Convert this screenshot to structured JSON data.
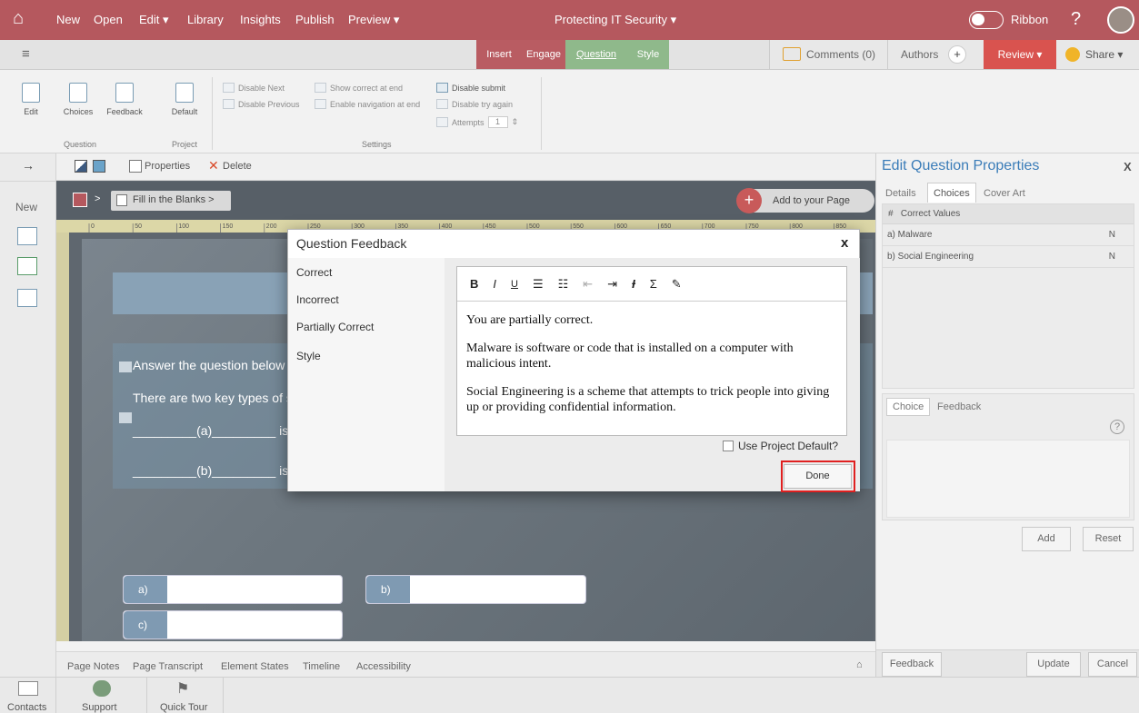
{
  "topbar": {
    "nav": [
      "New",
      "Open",
      "Edit ▾",
      "Library",
      "Insights",
      "Publish",
      "Preview ▾"
    ],
    "title": "Protecting IT Security ▾",
    "ribbon_toggle": "Ribbon",
    "help": "?"
  },
  "toolbar2": {
    "menu": "≡",
    "tabs": [
      "Insert",
      "Engage",
      "Question",
      "Style"
    ],
    "comments": "Comments (0)",
    "authors": "Authors",
    "authors_add": "+",
    "review": "Review ▾",
    "share": "Share ▾"
  },
  "ribbon": {
    "buttons": [
      "Edit",
      "Choices",
      "Feedback",
      "Default"
    ],
    "groups": [
      "Question",
      "Project",
      "Settings"
    ],
    "settings": [
      "Disable Next",
      "Disable Previous",
      "Show correct at end",
      "Enable navigation at end",
      "Disable submit",
      "Disable try again",
      "Attempts"
    ],
    "attempts_value": "1"
  },
  "leftrail": {
    "arrow": "→",
    "new": "New"
  },
  "canvas_toolbar": {
    "properties": "Properties",
    "delete": "Delete"
  },
  "pathbar": {
    "sep": ">",
    "crumb": "Fill in the Blanks >",
    "add_page": "Add to your Page"
  },
  "ruler_ticks": [
    "0",
    "50",
    "100",
    "150",
    "200",
    "250",
    "300",
    "350",
    "400",
    "450",
    "500",
    "550",
    "600",
    "650",
    "700",
    "750",
    "800",
    "850"
  ],
  "slide": {
    "instruction": "Answer the question below",
    "line1": "There are two key types of s",
    "blank_a": "_________(a)_________ is",
    "blank_b": "_________(b)_________ is",
    "answers": [
      "a)",
      "b)",
      "c)"
    ]
  },
  "bottom_tabs": [
    "Page Notes",
    "Page Transcript",
    "Element States",
    "Timeline",
    "Accessibility"
  ],
  "right_panel": {
    "title": "Edit Question Properties",
    "close": "X",
    "tabs": [
      "Details",
      "Choices",
      "Cover Art"
    ],
    "table_header": {
      "num": "#",
      "label": "Correct Values"
    },
    "rows": [
      {
        "label": "a)  Malware",
        "flag": "N"
      },
      {
        "label": "b)  Social Engineering",
        "flag": "N"
      }
    ],
    "subtabs": [
      "Choice",
      "Feedback"
    ],
    "help": "?",
    "add": "Add",
    "reset": "Reset",
    "feedback_btn": "Feedback",
    "update": "Update",
    "cancel": "Cancel"
  },
  "modal": {
    "title": "Question Feedback",
    "close": "x",
    "nav": [
      "Correct",
      "Incorrect",
      "Partially Correct",
      "Style"
    ],
    "toolbar": [
      "B",
      "I",
      "U",
      "Σ"
    ],
    "paragraphs": [
      "You are partially correct.",
      "Malware is software or code that is installed on a computer with malicious intent.",
      "Social Engineering is a scheme that attempts to trick people into giving up or providing confidential information."
    ],
    "checkbox_label": "Use Project Default?",
    "done": "Done"
  },
  "footer": [
    "Contacts",
    "Support",
    "Quick Tour"
  ],
  "colors": {
    "brand": "#b5585e",
    "accent_green": "#8fb98b",
    "review": "#d9534f"
  }
}
